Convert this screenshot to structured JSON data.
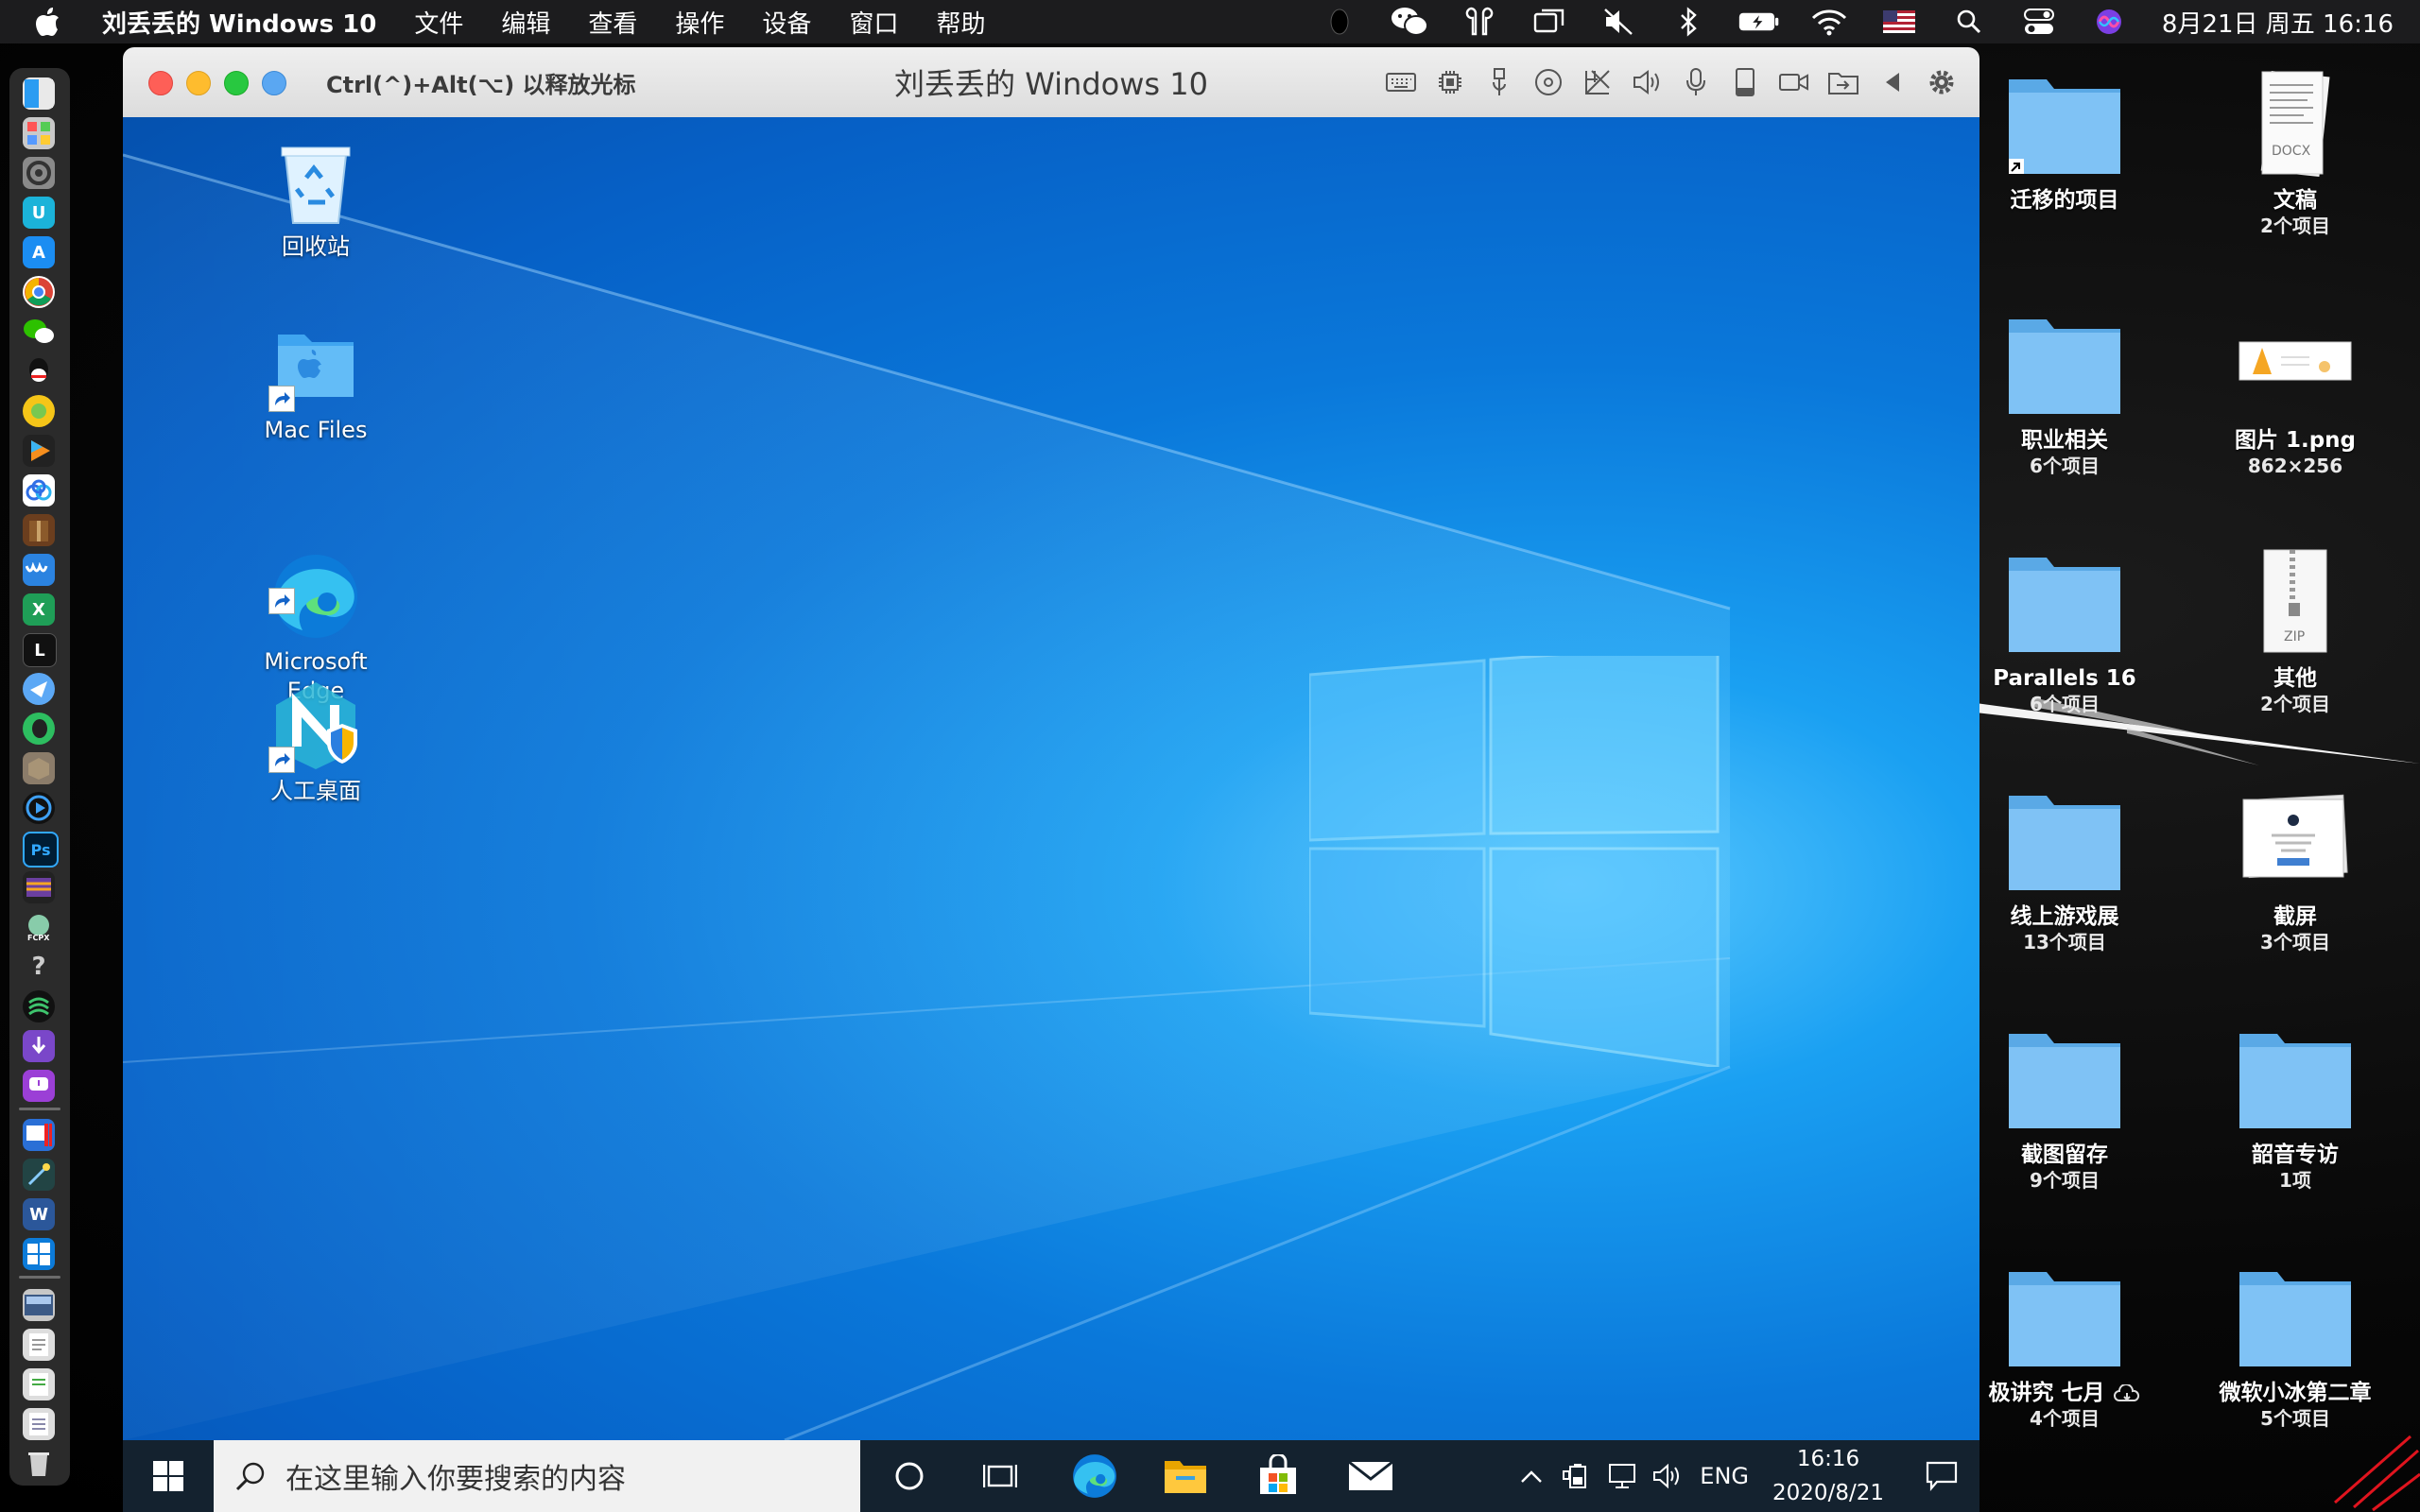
{
  "menubar": {
    "app_name": "刘丢丢的 Windows 10",
    "menus": [
      "文件",
      "编辑",
      "查看",
      "操作",
      "设备",
      "窗口",
      "帮助"
    ],
    "clock": "8月21日 周五 16:16"
  },
  "vm_window": {
    "hint": "Ctrl(^)+Alt(⌥) 以释放光标",
    "title": "刘丢丢的 Windows 10"
  },
  "windows": {
    "desktop_icons": [
      "回收站",
      "Mac Files",
      "Microsoft\nEdge",
      "人工桌面"
    ],
    "search_placeholder": "在这里输入你要搜索的内容",
    "tray": {
      "lang": "ENG",
      "time": "16:16",
      "date": "2020/8/21"
    }
  },
  "mac_desktop": {
    "items": [
      {
        "name": "迁移的项目",
        "info": "",
        "kind": "folder-alias"
      },
      {
        "name": "文稿",
        "info": "2个项目",
        "kind": "docx"
      },
      {
        "name": "职业相关",
        "info": "6个项目",
        "kind": "folder"
      },
      {
        "name": "图片 1.png",
        "info": "862×256",
        "kind": "image"
      },
      {
        "name": "Parallels 16",
        "info": "6个项目",
        "kind": "folder"
      },
      {
        "name": "其他",
        "info": "2个项目",
        "kind": "zip"
      },
      {
        "name": "线上游戏展",
        "info": "13个项目",
        "kind": "folder"
      },
      {
        "name": "截屏",
        "info": "3个项目",
        "kind": "screenshot"
      },
      {
        "name": "截图留存",
        "info": "9个项目",
        "kind": "folder"
      },
      {
        "name": "韶音专访",
        "info": "1项",
        "kind": "folder"
      },
      {
        "name": "极讲究 七月",
        "info": "4个项目",
        "kind": "folder-cloud"
      },
      {
        "name": "微软小冰第二章",
        "info": "5个项目",
        "kind": "folder"
      }
    ]
  }
}
